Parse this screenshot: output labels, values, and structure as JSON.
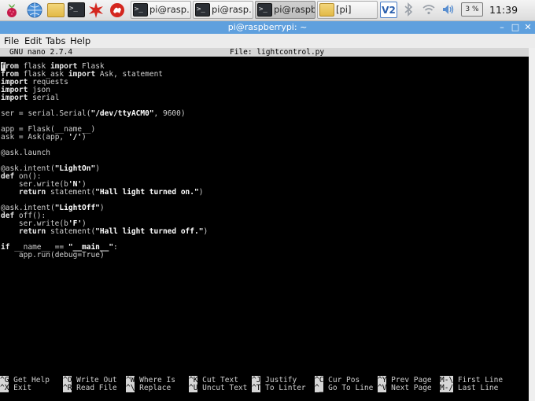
{
  "taskbar": {
    "tasks": [
      {
        "label": "pi@rasp…",
        "icon": "terminal-icon",
        "active": false
      },
      {
        "label": "pi@rasp…",
        "icon": "terminal-icon",
        "active": false
      },
      {
        "label": "pi@raspb…",
        "icon": "terminal-icon",
        "active": true
      },
      {
        "label": "[pi]",
        "icon": "folder-icon",
        "active": false
      }
    ],
    "vnc_label": "V2",
    "cpu_label": "3 %",
    "clock": "11:39",
    "term_glyph": ">_"
  },
  "window": {
    "title": "pi@raspberrypi: ~",
    "minimize_glyph": "–",
    "maximize_glyph": "□",
    "close_glyph": "✕"
  },
  "menu": {
    "file": "File",
    "edit": "Edit",
    "tabs": "Tabs",
    "help": "Help"
  },
  "nano": {
    "version": "GNU nano 2.7.4",
    "file_label": "File: lightcontrol.py",
    "code_lines": [
      "from flask import Flask",
      "from flask_ask import Ask, statement",
      "import requests",
      "import json",
      "import serial",
      "",
      "ser = serial.Serial(\"/dev/ttyACM0\", 9600)",
      "",
      "app = Flask(__name__)",
      "ask = Ask(app, '/')",
      "",
      "@ask.launch",
      "",
      "@ask.intent(\"LightOn\")",
      "def on():",
      "    ser.write(b'N')",
      "    return statement(\"Hall light turned on.\")",
      "",
      "@ask.intent(\"LightOff\")",
      "def off():",
      "    ser.write(b'F')",
      "    return statement(\"Hall light turned off.\")",
      "",
      "if __name__ == \"__main__\":",
      "    app.run(debug=True)"
    ],
    "shortcuts_row1": [
      {
        "key": "^G",
        "label": "Get Help"
      },
      {
        "key": "^O",
        "label": "Write Out"
      },
      {
        "key": "^W",
        "label": "Where Is"
      },
      {
        "key": "^K",
        "label": "Cut Text"
      },
      {
        "key": "^J",
        "label": "Justify"
      },
      {
        "key": "^C",
        "label": "Cur Pos"
      },
      {
        "key": "^Y",
        "label": "Prev Page"
      },
      {
        "key": "M-\\",
        "label": "First Line"
      }
    ],
    "shortcuts_row2": [
      {
        "key": "^X",
        "label": "Exit"
      },
      {
        "key": "^R",
        "label": "Read File"
      },
      {
        "key": "^\\",
        "label": "Replace"
      },
      {
        "key": "^U",
        "label": "Uncut Text"
      },
      {
        "key": "^T",
        "label": "To Linter"
      },
      {
        "key": "^_",
        "label": "Go To Line"
      },
      {
        "key": "^V",
        "label": "Next Page"
      },
      {
        "key": "M-/",
        "label": "Last Line"
      }
    ]
  },
  "colors": {
    "titlebar": "#5fa0de",
    "terminal_bg": "#000000",
    "nano_bar": "#d6d6d6"
  }
}
